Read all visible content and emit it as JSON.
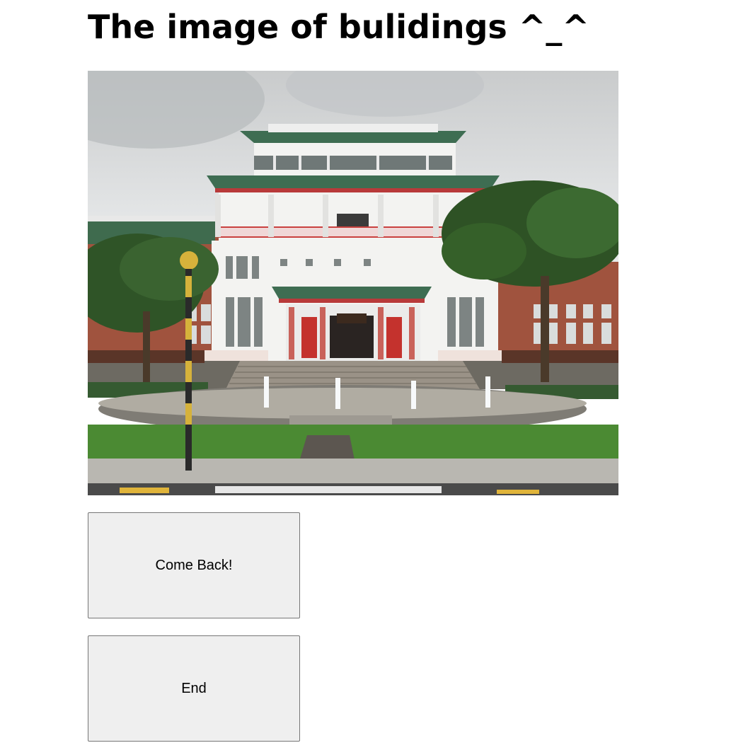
{
  "page": {
    "title": "The image of bulidings ^_^"
  },
  "photo": {
    "subject": "building-photo"
  },
  "buttons": {
    "back_label": "Come Back!",
    "end_label": "End"
  },
  "colors": {
    "background": "#ffffff",
    "button_bg": "#efefef",
    "button_border": "#767676",
    "text": "#000000"
  }
}
